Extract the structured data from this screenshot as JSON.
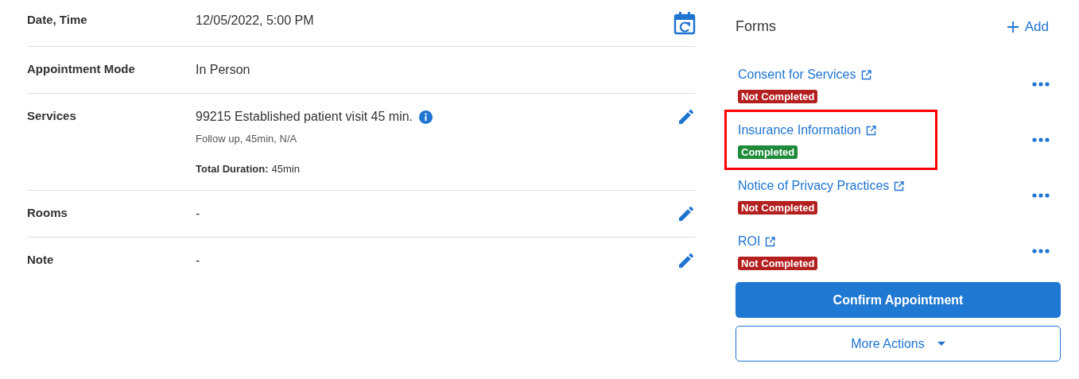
{
  "details": [
    {
      "label": "Date, Time",
      "value": "12/05/2022, 5:00 PM",
      "kind": "calendar"
    },
    {
      "label": "Appointment Mode",
      "value": "In Person"
    },
    {
      "label": "Services",
      "value": "99215 Established patient visit 45 min.",
      "info": true,
      "subtitle": "Follow up, 45min, N/A",
      "total_label": "Total Duration:",
      "total_value": "45min",
      "kind": "edit"
    },
    {
      "label": "Rooms",
      "value": "-",
      "kind": "edit"
    },
    {
      "label": "Note",
      "value": "-",
      "kind": "edit"
    }
  ],
  "forms": {
    "title": "Forms",
    "add_label": "Add",
    "items": [
      {
        "name": "Consent for Services",
        "status": "Not Completed",
        "completed": false,
        "highlighted": false
      },
      {
        "name": "Insurance Information",
        "status": "Completed",
        "completed": true,
        "highlighted": true
      },
      {
        "name": "Notice of Privacy Practices",
        "status": "Not Completed",
        "completed": false,
        "highlighted": false
      },
      {
        "name": "ROI",
        "status": "Not Completed",
        "completed": false,
        "highlighted": false
      }
    ]
  },
  "buttons": {
    "confirm": "Confirm Appointment",
    "more": "More Actions"
  }
}
